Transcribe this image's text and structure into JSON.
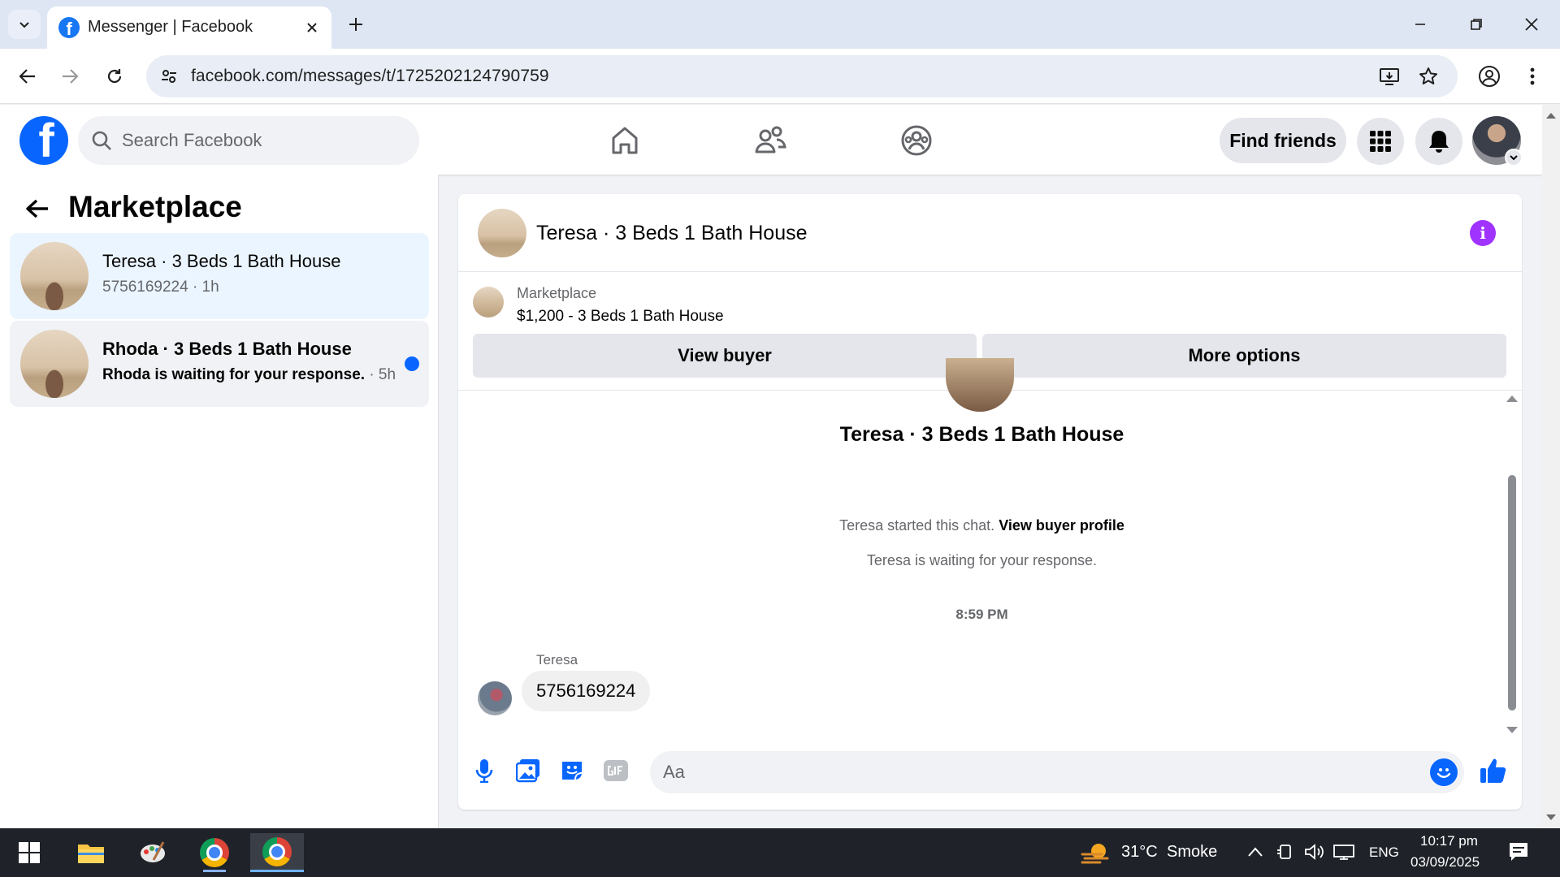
{
  "browser": {
    "tab_title": "Messenger | Facebook",
    "url": "facebook.com/messages/t/1725202124790759"
  },
  "fb_header": {
    "logo_letter": "f",
    "search_placeholder": "Search Facebook",
    "find_friends_label": "Find friends"
  },
  "sidebar": {
    "title": "Marketplace",
    "conversations": [
      {
        "name": "Teresa · 3 Beds 1 Bath House",
        "preview": "5756169224",
        "time": "· 1h",
        "unread": false,
        "active": true
      },
      {
        "name": "Rhoda · 3 Beds 1 Bath House",
        "preview": "Rhoda is waiting for your response.",
        "time": "· 5h",
        "unread": true,
        "active": false
      }
    ]
  },
  "chat": {
    "header_name": "Teresa · 3 Beds 1 Bath House",
    "info_glyph": "i",
    "listing": {
      "kicker": "Marketplace",
      "title": "$1,200 - 3 Beds 1 Bath House",
      "view_buyer_label": "View buyer",
      "more_options_label": "More options"
    },
    "intro_name": "Teresa · 3 Beds 1 Bath House",
    "started_text": "Teresa started this chat.",
    "view_profile_link": "View buyer profile",
    "waiting_text": "Teresa is waiting for your response.",
    "timestamp": "8:59 PM",
    "messages": [
      {
        "sender": "Teresa",
        "text": "5756169224"
      }
    ],
    "composer_placeholder": "Aa"
  },
  "taskbar": {
    "weather_temp": "31°C",
    "weather_desc": "Smoke",
    "language": "ENG",
    "time": "10:17 pm",
    "date": "03/09/2025"
  },
  "colors": {
    "fb_blue": "#0866ff",
    "info_purple": "#a033ff",
    "active_conv_bg": "#ebf5ff"
  }
}
